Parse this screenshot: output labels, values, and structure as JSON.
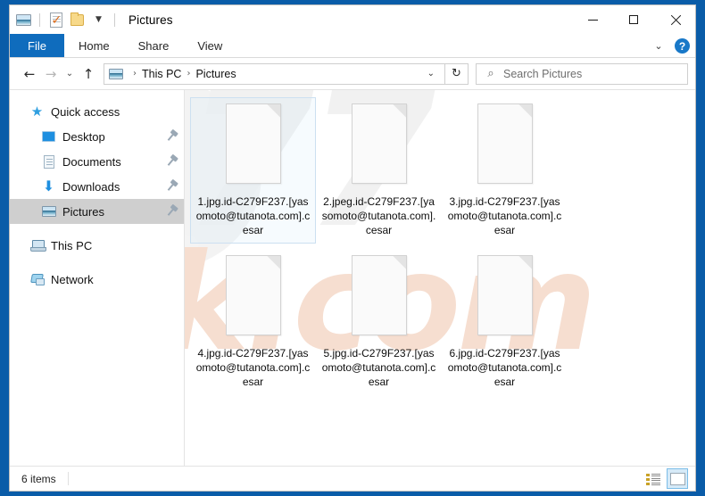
{
  "window": {
    "title": "Pictures",
    "quick_access_icons": [
      "picture-icon",
      "properties-icon",
      "new-folder-icon",
      "customize-caret-icon"
    ],
    "controls": {
      "minimize": "minimize-icon",
      "maximize": "maximize-icon",
      "close": "close-icon"
    }
  },
  "ribbon": {
    "tabs": [
      {
        "label": "File",
        "active": true
      },
      {
        "label": "Home",
        "active": false
      },
      {
        "label": "Share",
        "active": false
      },
      {
        "label": "View",
        "active": false
      }
    ],
    "expand_icon": "chevron-down-icon",
    "help_label": "?"
  },
  "address": {
    "back": "◄",
    "forward": "►",
    "history": "▾",
    "up": "▲",
    "crumbs": [
      "This PC",
      "Pictures"
    ],
    "separator": "›",
    "dropdown": "▾",
    "refresh": "↻"
  },
  "search": {
    "placeholder": "Search Pictures",
    "icon": "search-icon",
    "value": ""
  },
  "sidebar": {
    "items": [
      {
        "label": "Quick access",
        "icon": "star-icon",
        "level": "group",
        "pinned": false,
        "selected": false
      },
      {
        "label": "Desktop",
        "icon": "desktop-icon",
        "level": "child",
        "pinned": true,
        "selected": false
      },
      {
        "label": "Documents",
        "icon": "documents-icon",
        "level": "child",
        "pinned": true,
        "selected": false
      },
      {
        "label": "Downloads",
        "icon": "downloads-icon",
        "level": "child",
        "pinned": true,
        "selected": false
      },
      {
        "label": "Pictures",
        "icon": "pictures-icon",
        "level": "child",
        "pinned": true,
        "selected": true
      },
      {
        "label": "This PC",
        "icon": "this-pc-icon",
        "level": "group",
        "pinned": false,
        "selected": false
      },
      {
        "label": "Network",
        "icon": "network-icon",
        "level": "group",
        "pinned": false,
        "selected": false
      }
    ]
  },
  "files": [
    {
      "name": "1.jpg.id-C279F237.[yasomoto@tutanota.com].cesar",
      "selected": true
    },
    {
      "name": "2.jpeg.id-C279F237.[yasomoto@tutanota.com].cesar",
      "selected": false
    },
    {
      "name": "3.jpg.id-C279F237.[yasomoto@tutanota.com].cesar",
      "selected": false
    },
    {
      "name": "4.jpg.id-C279F237.[yasomoto@tutanota.com].cesar",
      "selected": false
    },
    {
      "name": "5.jpg.id-C279F237.[yasomoto@tutanota.com].cesar",
      "selected": false
    },
    {
      "name": "6.jpg.id-C279F237.[yasomoto@tutanota.com].cesar",
      "selected": false
    }
  ],
  "statusbar": {
    "item_count": "6 items",
    "views": [
      {
        "name": "details-view",
        "active": false
      },
      {
        "name": "large-icons-view",
        "active": true
      }
    ]
  },
  "watermark": {
    "text": "risk.com"
  },
  "colors": {
    "accent_blue": "#0f6cbd",
    "desktop_blue": "#0a5ca8",
    "selection_border": "#cce0f1",
    "nav_selected": "#cfcfcf",
    "help_blue": "#1878c8"
  }
}
